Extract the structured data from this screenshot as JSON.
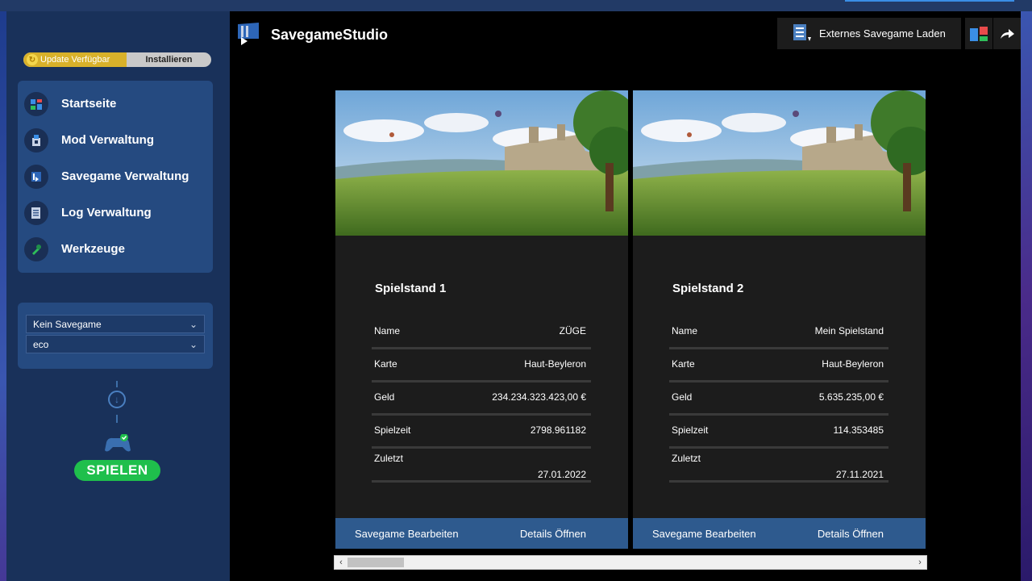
{
  "sidebar": {
    "update": {
      "label": "Update Verfügbar",
      "action": "Installieren"
    },
    "nav": [
      {
        "label": "Startseite",
        "icon": "home-icon"
      },
      {
        "label": "Mod Verwaltung",
        "icon": "mod-icon"
      },
      {
        "label": "Savegame Verwaltung",
        "icon": "savegame-icon"
      },
      {
        "label": "Log Verwaltung",
        "icon": "log-icon"
      },
      {
        "label": "Werkzeuge",
        "icon": "tools-icon"
      }
    ],
    "savegame_select": "Kein Savegame",
    "profile_select": "eco",
    "play_label": "SPIELEN"
  },
  "header": {
    "title": "SavegameStudio",
    "external_button": "Externes Savegame Laden"
  },
  "cards": [
    {
      "title": "Spielstand 1",
      "rows": [
        {
          "key": "Name",
          "value": "ZÜGE"
        },
        {
          "key": "Karte",
          "value": "Haut-Beyleron"
        },
        {
          "key": "Geld",
          "value": "234.234.323.423,00 €"
        },
        {
          "key": "Spielzeit",
          "value": "2798.961182"
        },
        {
          "key": "Zuletzt",
          "value": "27.01.2022"
        }
      ],
      "edit": "Savegame Bearbeiten",
      "details": "Details Öffnen"
    },
    {
      "title": "Spielstand 2",
      "rows": [
        {
          "key": "Name",
          "value": "Mein Spielstand"
        },
        {
          "key": "Karte",
          "value": "Haut-Beyleron"
        },
        {
          "key": "Geld",
          "value": "5.635.235,00 €"
        },
        {
          "key": "Spielzeit",
          "value": "114.353485"
        },
        {
          "key": "Zuletzt",
          "value": "27.11.2021"
        }
      ],
      "edit": "Savegame Bearbeiten",
      "details": "Details Öffnen"
    }
  ],
  "colors": {
    "sidebar": "#19315a",
    "panel": "#254a80",
    "update": "#d8b12a",
    "play": "#1fbf4c",
    "card": "#1c1c1c",
    "card_footer": "#2e5a8e"
  }
}
